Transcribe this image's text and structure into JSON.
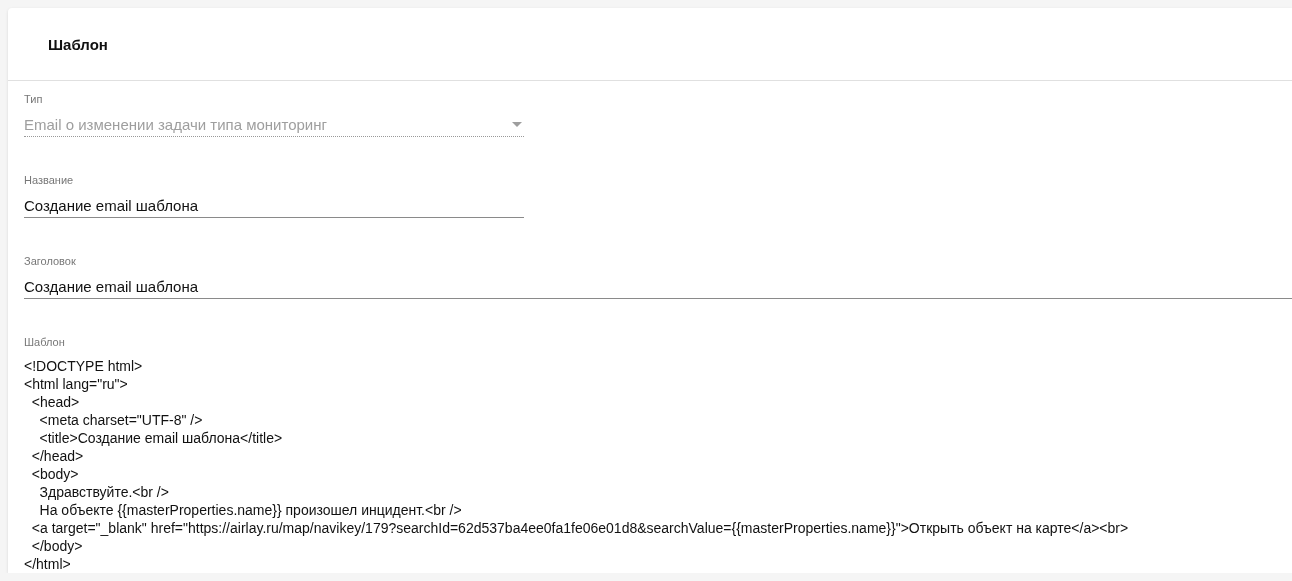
{
  "card": {
    "title": "Шаблон"
  },
  "fields": [
    {
      "kind": "select",
      "label": "Тип",
      "value": "Email о изменении задачи типа мониторинг",
      "disabled": true,
      "wide": false
    },
    {
      "kind": "text",
      "label": "Название",
      "value": "Создание email шаблона",
      "disabled": false,
      "wide": false
    },
    {
      "kind": "text",
      "label": "Заголовок",
      "value": "Создание email шаблона",
      "disabled": false,
      "wide": true
    },
    {
      "kind": "multiline",
      "label": "Шаблон",
      "value": "<!DOCTYPE html>\n<html lang=\"ru\">\n  <head>\n    <meta charset=\"UTF-8\" />\n    <title>Создание email шаблона</title>\n  </head>\n  <body>\n    Здравствуйте.<br />\n    На объекте {{masterProperties.name}} произошел инцидент.<br />\n  <a target=\"_blank\" href=\"https://airlay.ru/map/navikey/179?searchId=62d537ba4ee0fa1fe06e01d8&searchValue={{masterProperties.name}}\">Открыть объект на карте</a><br>\n  </body>\n</html>",
      "disabled": false,
      "wide": true
    }
  ]
}
